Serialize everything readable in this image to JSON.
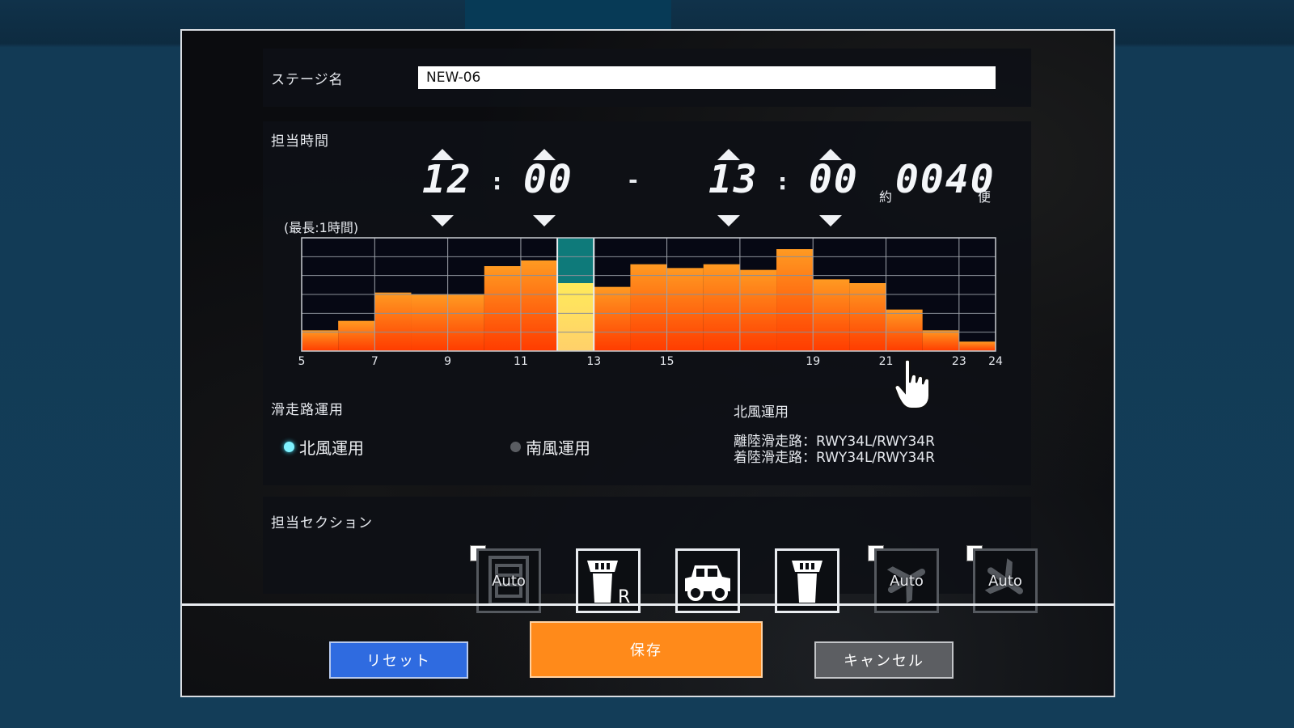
{
  "stage": {
    "label": "ステージ名",
    "value": "NEW-06"
  },
  "shift": {
    "label": "担当時間",
    "max_note": "(最長:1時間)",
    "start_hour": "12",
    "start_min": "00",
    "end_hour": "13",
    "end_min": "00",
    "colon": ":",
    "dash": "-",
    "approx_prefix": "約",
    "flights": "0040",
    "flights_suffix": "便"
  },
  "chart_data": {
    "type": "bar",
    "x_ticks": [
      "5",
      "7",
      "9",
      "11",
      "13",
      "15",
      "19",
      "21",
      "23",
      "24"
    ],
    "xlim": [
      5,
      24
    ],
    "ylim": [
      0,
      6
    ],
    "bins_start_hour": 5,
    "bin_width_hours": 1,
    "values": [
      1.1,
      1.6,
      3.1,
      3.0,
      3.0,
      4.5,
      4.8,
      6.0,
      3.4,
      4.6,
      4.4,
      4.6,
      4.3,
      5.4,
      3.8,
      3.6,
      2.2,
      1.1,
      0.5
    ],
    "selected_range": [
      12,
      13
    ],
    "selected_value": 3.6,
    "colors": {
      "bar_top": "#ff9a22",
      "bar_bottom": "#ff3c00",
      "selected_fill": "#ffd06a",
      "selected_top": "#ffea5a",
      "selected_bg": "#0e7a7a"
    }
  },
  "runway": {
    "label": "滑走路運用",
    "options": [
      {
        "label": "北風運用",
        "selected": true
      },
      {
        "label": "南風運用",
        "selected": false
      }
    ],
    "info_title": "北風運用",
    "departure": "離陸滑走路：RWY34L/RWY34R",
    "arrival": "着陸滑走路：RWY34L/RWY34R"
  },
  "sections": {
    "label": "担当セクション",
    "auto_text": "Auto",
    "tower_r_text": "R"
  },
  "buttons": {
    "reset": "リセット",
    "save": "保存",
    "cancel": "キャンセル"
  }
}
